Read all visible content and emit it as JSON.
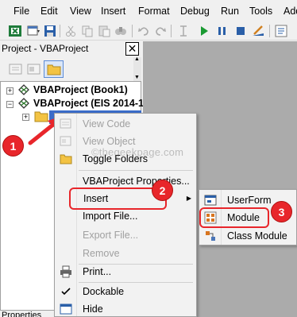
{
  "menubar": {
    "items": [
      "File",
      "Edit",
      "View",
      "Insert",
      "Format",
      "Debug",
      "Run",
      "Tools",
      "Add"
    ]
  },
  "project_panel": {
    "title": "Project - VBAProject",
    "close_glyph": "✕",
    "tree": [
      {
        "label": "VBAProject (Book1)",
        "expander": "+"
      },
      {
        "label": "VBAProject (EIS 2014-1",
        "expander": "−"
      }
    ],
    "properties_label": "Properties"
  },
  "context_menu": {
    "items": [
      {
        "label": "View Code",
        "disabled": true,
        "icon": "view-code-icon"
      },
      {
        "label": "View Object",
        "disabled": true,
        "icon": "view-object-icon"
      },
      {
        "label": "Toggle Folders",
        "disabled": false,
        "icon": "folder-icon"
      },
      {
        "label": "VBAProject Properties...",
        "disabled": false
      },
      {
        "label": "Insert",
        "disabled": false,
        "submenu_arrow": "▶"
      },
      {
        "label": "Import File...",
        "disabled": false
      },
      {
        "label": "Export File...",
        "disabled": true
      },
      {
        "label": "Remove",
        "disabled": true
      },
      {
        "label": "Print...",
        "disabled": false,
        "icon": "printer-icon"
      },
      {
        "label": "Dockable",
        "disabled": false,
        "icon": "check-icon",
        "checked": true
      },
      {
        "label": "Hide",
        "disabled": false,
        "icon": "hide-icon"
      }
    ]
  },
  "insert_submenu": {
    "items": [
      {
        "label": "UserForm",
        "icon": "userform-icon"
      },
      {
        "label": "Module",
        "icon": "module-icon"
      },
      {
        "label": "Class Module",
        "icon": "class-module-icon"
      }
    ]
  },
  "annotations": {
    "badge1": "1",
    "badge2": "2",
    "badge3": "3",
    "accent_color": "#e8262b"
  },
  "watermark": "©thegeekpage.com"
}
